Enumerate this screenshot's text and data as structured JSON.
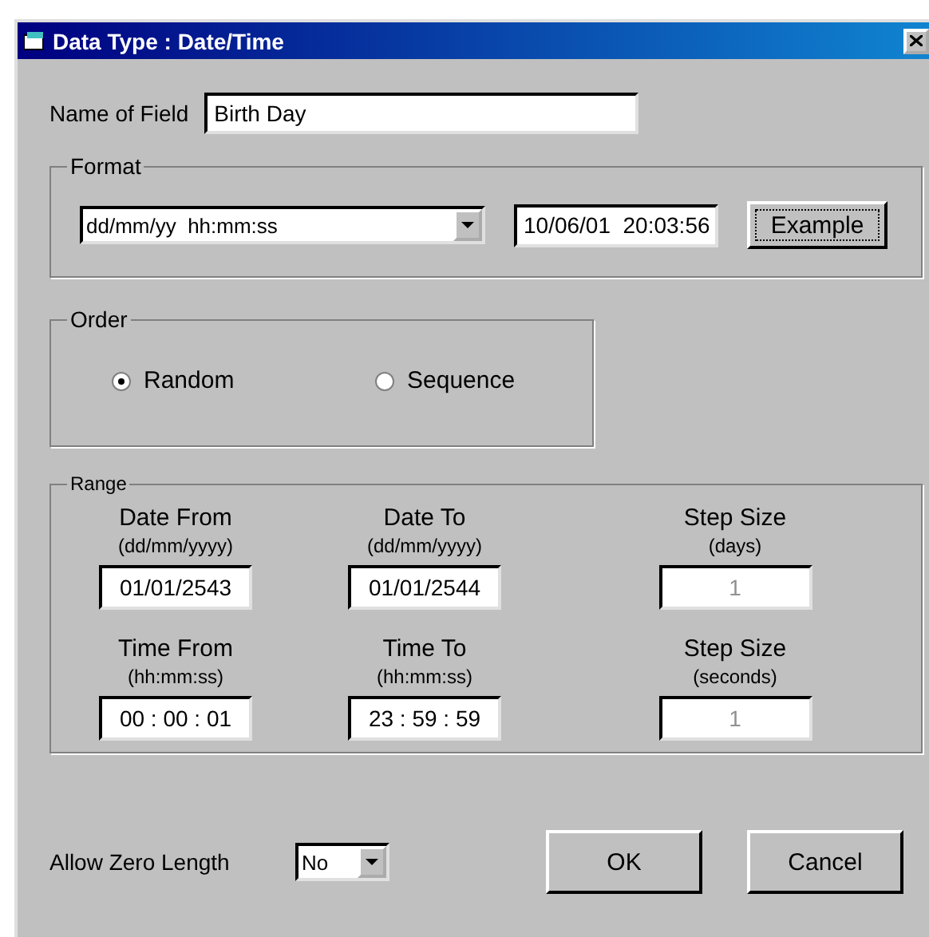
{
  "window": {
    "title": "Data Type : Date/Time"
  },
  "name_field": {
    "label": "Name of Field",
    "value": "Birth Day"
  },
  "format": {
    "legend": "Format",
    "selected_format": "dd/mm/yy  hh:mm:ss",
    "example_value": "10/06/01  20:03:56",
    "example_button": "Example"
  },
  "order": {
    "legend": "Order",
    "options": [
      {
        "label": "Random",
        "selected": true
      },
      {
        "label": "Sequence",
        "selected": false
      }
    ]
  },
  "range": {
    "legend": "Range",
    "fields": [
      {
        "label": "Date From",
        "hint": "(dd/mm/yyyy)",
        "value": "01/01/2543",
        "disabled": false
      },
      {
        "label": "Date To",
        "hint": "(dd/mm/yyyy)",
        "value": "01/01/2544",
        "disabled": false
      },
      {
        "label": "Step Size",
        "hint": "(days)",
        "value": "1",
        "disabled": true
      },
      {
        "label": "Time From",
        "hint": "(hh:mm:ss)",
        "value": "00 : 00 : 01",
        "disabled": false
      },
      {
        "label": "Time To",
        "hint": "(hh:mm:ss)",
        "value": "23 : 59 : 59",
        "disabled": false
      },
      {
        "label": "Step Size",
        "hint": "(seconds)",
        "value": "1",
        "disabled": true
      }
    ]
  },
  "allow_zero_length": {
    "label": "Allow Zero Length",
    "value": "No"
  },
  "buttons": [
    "OK",
    "Cancel"
  ]
}
